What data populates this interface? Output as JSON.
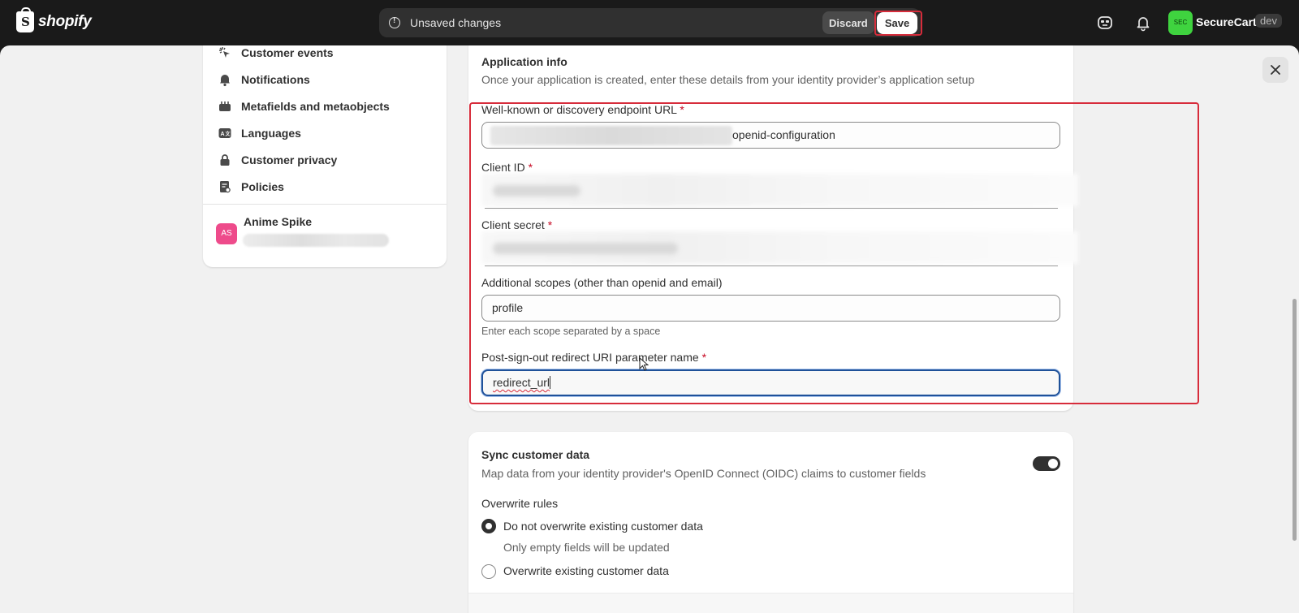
{
  "topbar": {
    "logo_text": "shopify",
    "unsaved_text": "Unsaved changes",
    "discard_label": "Discard",
    "save_label": "Save",
    "store_avatar": "SEC",
    "store_name": "SecureCart",
    "store_tag": "dev"
  },
  "sidebar": {
    "items": [
      {
        "label": "Customer events",
        "icon": "cursor-click-icon"
      },
      {
        "label": "Notifications",
        "icon": "bell-icon"
      },
      {
        "label": "Metafields and metaobjects",
        "icon": "metafields-icon"
      },
      {
        "label": "Languages",
        "icon": "language-icon"
      },
      {
        "label": "Customer privacy",
        "icon": "lock-icon"
      },
      {
        "label": "Policies",
        "icon": "policy-icon"
      }
    ],
    "user": {
      "initials": "AS",
      "name": "Anime Spike"
    }
  },
  "app_info": {
    "title": "Application info",
    "subtitle": "Once your application is created, enter these details from your identity provider’s application setup",
    "discovery_label": "Well-known or discovery endpoint URL",
    "discovery_value_tail": "openid-configuration",
    "client_id_label": "Client ID",
    "client_secret_label": "Client secret",
    "scopes_label": "Additional scopes (other than openid and email)",
    "scopes_value": "profile",
    "scopes_help": "Enter each scope separated by a space",
    "redirect_label": "Post-sign-out redirect URI parameter name",
    "redirect_value": "redirect_url",
    "required_mark": "*"
  },
  "sync": {
    "title": "Sync customer data",
    "subtitle": "Map data from your identity provider's OpenID Connect (OIDC) claims to customer fields",
    "toggle_on": true,
    "overwrite_title": "Overwrite rules",
    "option1_label": "Do not overwrite existing customer data",
    "option1_help": "Only empty fields will be updated",
    "option2_label": "Overwrite existing customer data"
  },
  "colors": {
    "highlight": "#d72c3b",
    "focus": "#1f5199",
    "store_avatar": "#3fd33f",
    "user_avatar": "#ee4b8b"
  }
}
